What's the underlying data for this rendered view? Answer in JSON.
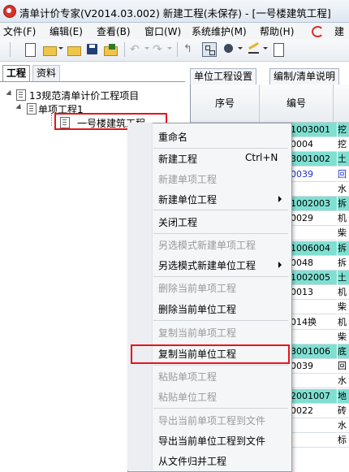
{
  "window": {
    "title": "清单计价专家(V2014.03.002) 新建工程(未保存) - [一号楼建筑工程]"
  },
  "menubar": [
    "文件(F)",
    "编辑(E)",
    "查看(B)",
    "窗口(W)",
    "系统维护(M)",
    "帮助(H)",
    "建"
  ],
  "left_tabs": [
    "工程",
    "资料"
  ],
  "tree": {
    "root": "13规范清单计价工程项目",
    "level1": "单项工程1",
    "level2": "一号楼建筑工程"
  },
  "right_tabs": [
    "单位工程设置",
    "编制/清单说明"
  ],
  "grid": {
    "headers": [
      "序号",
      "编号"
    ],
    "rows": [
      {
        "code": "1003001",
        "name": "挖",
        "bg": "#7fe0d2",
        "color": "#000"
      },
      {
        "code": "0004",
        "name": "挖",
        "bg": "#ffffff",
        "color": "#000"
      },
      {
        "code": "3001002",
        "name": "土",
        "bg": "#7fe0d2",
        "color": "#000"
      },
      {
        "code": "0039",
        "name": "回",
        "bg": "#ffffff",
        "color": "#1a2fd2"
      },
      {
        "code": "",
        "name": "水",
        "bg": "#ffffff",
        "color": "#000"
      },
      {
        "code": "1002003",
        "name": "拆",
        "bg": "#7fe0d2",
        "color": "#000"
      },
      {
        "code": "0029",
        "name": "机",
        "bg": "#ffffff",
        "color": "#000"
      },
      {
        "code": "",
        "name": "柴",
        "bg": "#ffffff",
        "color": "#000"
      },
      {
        "code": "1006004",
        "name": "拆",
        "bg": "#7fe0d2",
        "color": "#000"
      },
      {
        "code": "0048",
        "name": "拆",
        "bg": "#ffffff",
        "color": "#000"
      },
      {
        "code": "1002005",
        "name": "土",
        "bg": "#7fe0d2",
        "color": "#000"
      },
      {
        "code": "0013",
        "name": "机",
        "bg": "#ffffff",
        "color": "#000"
      },
      {
        "code": "",
        "name": "柴",
        "bg": "#ffffff",
        "color": "#000"
      },
      {
        "code": "014换",
        "name": "机",
        "bg": "#ffffff",
        "color": "#000"
      },
      {
        "code": "",
        "name": "柴",
        "bg": "#ffffff",
        "color": "#000"
      },
      {
        "code": "3001006",
        "name": "底",
        "bg": "#7fe0d2",
        "color": "#000"
      },
      {
        "code": "0039",
        "name": "回",
        "bg": "#ffffff",
        "color": "#000"
      },
      {
        "code": "",
        "name": "水",
        "bg": "#ffffff",
        "color": "#000"
      },
      {
        "code": "2001007",
        "name": "地",
        "bg": "#7fe0d2",
        "color": "#000"
      },
      {
        "code": "0022",
        "name": "砖",
        "bg": "#ffffff",
        "color": "#000"
      },
      {
        "code": "",
        "name": "水",
        "bg": "#ffffff",
        "color": "#000"
      },
      {
        "code": "",
        "name": "标",
        "bg": "#ffffff",
        "color": "#000"
      }
    ]
  },
  "context_menu": {
    "items": [
      {
        "label": "重命名",
        "disabled": false
      },
      {
        "label": "新建工程",
        "shortcut": "Ctrl+N",
        "disabled": false
      },
      {
        "label": "新建单项工程",
        "disabled": true
      },
      {
        "label": "新建单位工程",
        "disabled": false,
        "submenu": true
      },
      {
        "label": "关闭工程",
        "disabled": false
      },
      {
        "label": "另选模式新建单项工程",
        "disabled": true
      },
      {
        "label": "另选模式新建单位工程",
        "disabled": false,
        "submenu": true
      },
      {
        "label": "删除当前单项工程",
        "disabled": true
      },
      {
        "label": "删除当前单位工程",
        "disabled": false
      },
      {
        "label": "复制当前单项工程",
        "disabled": true
      },
      {
        "label": "复制当前单位工程",
        "disabled": false,
        "highlighted": true
      },
      {
        "label": "粘贴单项工程",
        "disabled": true
      },
      {
        "label": "粘贴单位工程",
        "disabled": true
      },
      {
        "label": "导出当前单项工程到文件",
        "disabled": true
      },
      {
        "label": "导出当前单位工程到文件",
        "disabled": false
      },
      {
        "label": "从文件归并工程",
        "disabled": false
      }
    ]
  },
  "colors": {
    "highlight_border": "#e8141b",
    "row_teal": "#7fe0d2",
    "disabled_text": "#9a9a9a"
  }
}
